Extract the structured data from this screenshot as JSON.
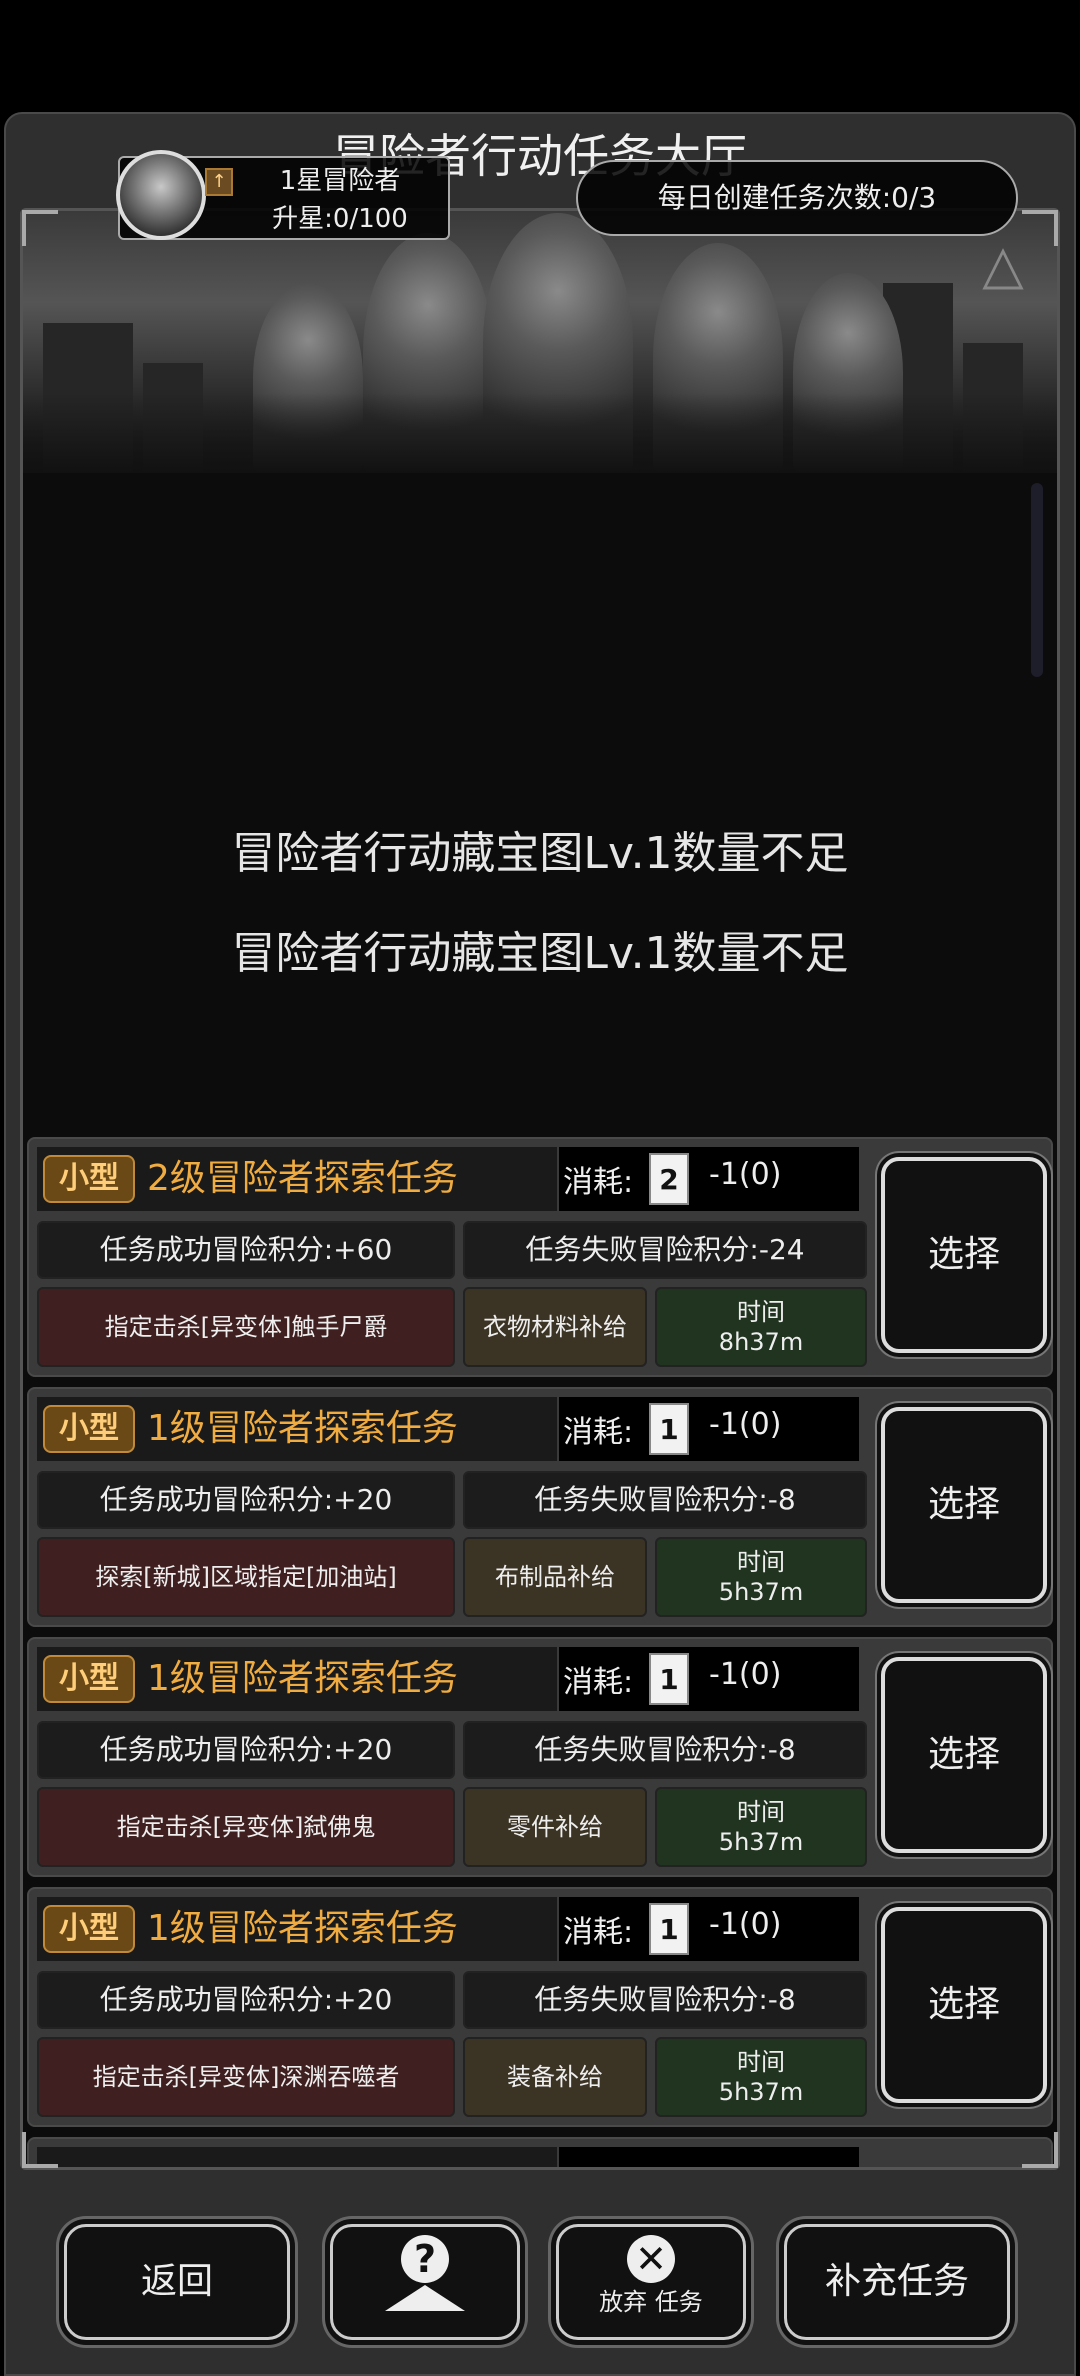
{
  "title": "冒险者行动任务大厅",
  "rank": {
    "name": "1星冒险者",
    "progress": "升星:0/100",
    "icon": "up-arrow-icon"
  },
  "daily": "每日创建任务次数:0/3",
  "notices": [
    "冒险者行动藏宝图Lv.1数量不足",
    "冒险者行动藏宝图Lv.1数量不足"
  ],
  "tasks": [
    {
      "badge": "小型",
      "title": "2级冒险者探索任务",
      "cost_label": "消耗:",
      "cost_icon": "2",
      "cost_value": "-1(0)",
      "success": "任务成功冒险积分:+60",
      "fail": "任务失败冒险积分:-24",
      "target": "指定击杀[异变体]触手尸爵",
      "supply": "衣物材料补给",
      "time_label": "时间",
      "time_value": "8h37m",
      "select": "选择"
    },
    {
      "badge": "小型",
      "title": "1级冒险者探索任务",
      "cost_label": "消耗:",
      "cost_icon": "1",
      "cost_value": "-1(0)",
      "success": "任务成功冒险积分:+20",
      "fail": "任务失败冒险积分:-8",
      "target": "探索[新城]区域指定[加油站]",
      "supply": "布制品补给",
      "time_label": "时间",
      "time_value": "5h37m",
      "select": "选择"
    },
    {
      "badge": "小型",
      "title": "1级冒险者探索任务",
      "cost_label": "消耗:",
      "cost_icon": "1",
      "cost_value": "-1(0)",
      "success": "任务成功冒险积分:+20",
      "fail": "任务失败冒险积分:-8",
      "target": "指定击杀[异变体]弑佛鬼",
      "supply": "零件补给",
      "time_label": "时间",
      "time_value": "5h37m",
      "select": "选择"
    },
    {
      "badge": "小型",
      "title": "1级冒险者探索任务",
      "cost_label": "消耗:",
      "cost_icon": "1",
      "cost_value": "-1(0)",
      "success": "任务成功冒险积分:+20",
      "fail": "任务失败冒险积分:-8",
      "target": "指定击杀[异变体]深渊吞噬者",
      "supply": "装备补给",
      "time_label": "时间",
      "time_value": "5h37m",
      "select": "选择"
    }
  ],
  "bottom": {
    "back": "返回",
    "help_icon": "?",
    "abandon_icon": "✕",
    "abandon": "放弃 任务",
    "replenish": "补充任务"
  },
  "colors": {
    "task_title": "#f0ac40",
    "badge_bg": "#6b4916",
    "target_bg": "#3f1f1f",
    "time_bg": "#203420"
  }
}
